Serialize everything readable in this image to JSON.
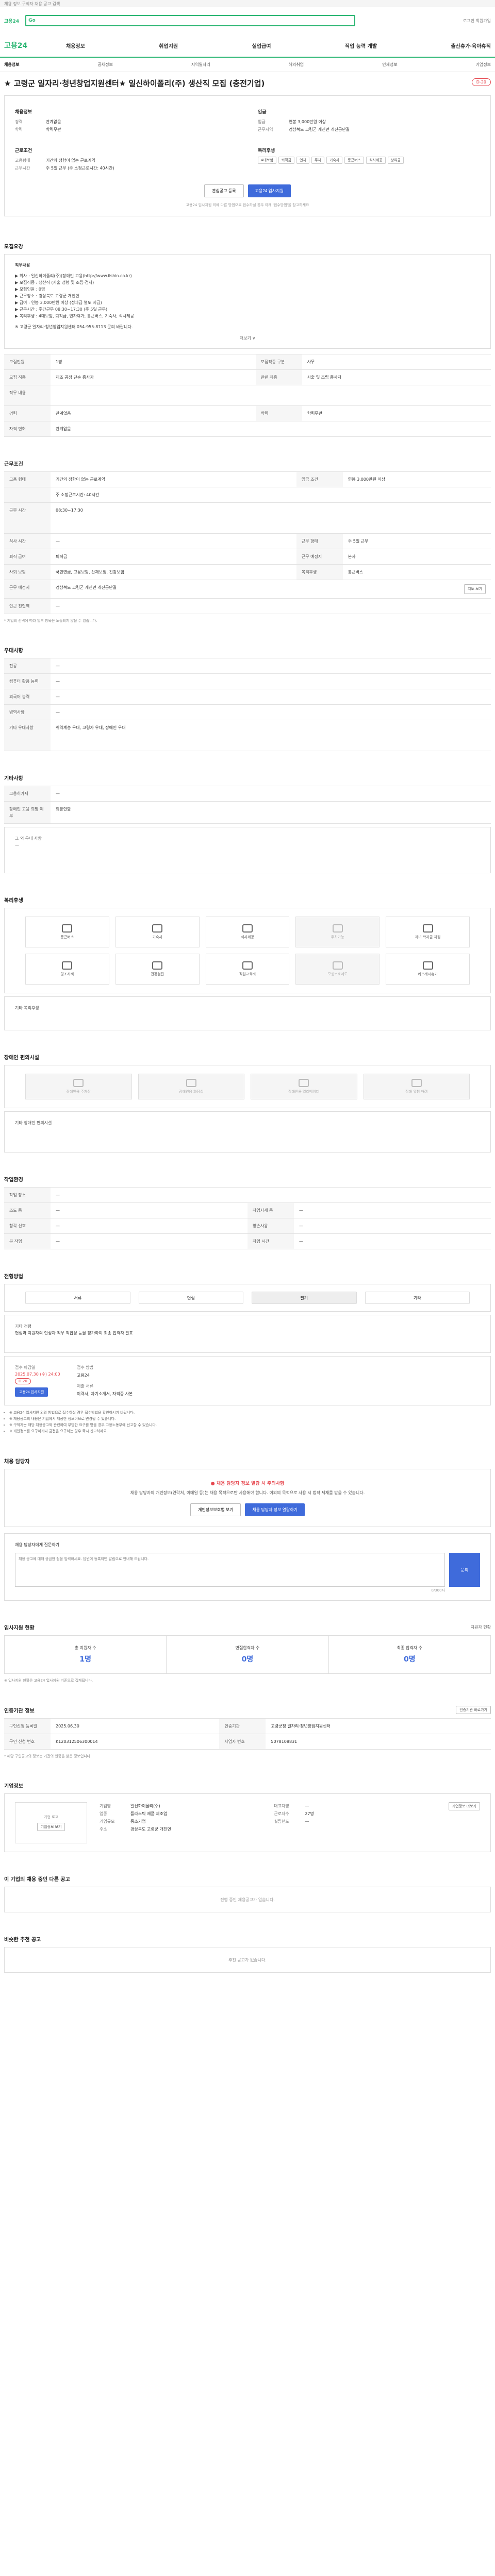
{
  "topstrip": {
    "text": "채용 정보 구직자 채용 공고 검색"
  },
  "search": {
    "logo": "고용24",
    "go": "Go",
    "placeholder": "",
    "util": "로그인 회원가입"
  },
  "gnb": {
    "brand": "고용24",
    "menu": [
      "채용정보",
      "취업지원",
      "실업급여",
      "직업 능력 개발",
      "출산휴가·육아휴직"
    ]
  },
  "subnav": {
    "items": [
      "채용정보",
      "공채정보",
      "지역일자리",
      "해외취업",
      "인재정보",
      "기업정보"
    ]
  },
  "title": {
    "text": "★ 고령군 일자리·청년창업지원센터★ 일신하이폴리(주) 생산직 모집 (충전기업)",
    "dday": "D-20"
  },
  "summary": {
    "left_head": "채용정보",
    "left": [
      {
        "k": "경력",
        "v": "관계없음"
      },
      {
        "k": "학력",
        "v": "학력무관"
      }
    ],
    "left2_head": "근로조건",
    "left2": [
      {
        "k": "고용형태",
        "v": "기간의 정함이 없는 근로계약"
      },
      {
        "k": "근무시간",
        "v": "주 5일 근무 (주 소정근로시간: 40시간)"
      }
    ],
    "right_head": "임금",
    "right": [
      {
        "k": "임금",
        "v": "연봉 3,000만원 이상"
      },
      {
        "k": "근무지역",
        "v": "경상북도 고령군 개진면 개진공단길"
      }
    ],
    "right2_head": "복리후생",
    "tags": [
      "4대보험",
      "퇴직금",
      "연차",
      "주차",
      "기숙사",
      "통근버스",
      "식사제공",
      "상여금"
    ],
    "btn_like": "관심공고 등록",
    "btn_apply": "고용24 입사지원",
    "note": "고용24 입사지원 외에 다른 방법으로 접수하실 경우 아래 '접수방법'을 참고하세요"
  },
  "recruit": {
    "head": "모집요강",
    "lines": [
      "직무내용",
      "▶ 회사 : 일신하이폴리(주)(장애인 고용(http://www.ilshin.co.kr)",
      "▶ 모집직종 : 생산직 (사출 성형 및 조립·검사)",
      "▶ 모집인원 : 0명",
      "▶ 근무장소 : 경상북도 고령군 개진면",
      "▶ 급여 : 연봉 3,000만원 이상 (성과급 별도 지급)",
      "▶ 근무시간 : 주간근무 08:30~17:30 (주 5일 근무)",
      "▶ 복리후생 : 4대보험, 퇴직금, 연차휴가, 통근버스, 기숙사, 식사제공",
      "※ 고령군 일자리·청년창업지원센터 054-955-8113 문의 바랍니다."
    ],
    "more": "더보기 ∨"
  },
  "jobinfo": [
    {
      "k1": "모집인원",
      "v1": "1명",
      "k2": "모집직종 구분",
      "v2": "사무"
    },
    {
      "k1": "모집 직종",
      "v1": "제조 공정 단순 종사자",
      "k2": "관련 직종",
      "v2": "사출 및 조립 종사자"
    },
    {
      "k1": "직무 내용",
      "v1": "",
      "k2": "",
      "v2": ""
    },
    {
      "k1": "경력",
      "v1": "관계없음",
      "k2": "학력",
      "v2": "학력무관"
    },
    {
      "k1": "자격 면허",
      "v1": "관계없음",
      "k2": "",
      "v2": ""
    }
  ],
  "work": {
    "head": "근무조건",
    "rows": [
      {
        "k1": "고용 형태",
        "v1": "기간의 정함이 없는 근로계약",
        "k2": "임금 조건",
        "v2": "연봉 3,000만원 이상"
      },
      {
        "k1": "",
        "v1": "주 소정근로시간: 40시간",
        "k2": "",
        "v2": ""
      },
      {
        "k1": "근무 시간",
        "v1": "08:30~17:30",
        "k2": "",
        "v2": ""
      },
      {
        "k1": "식사 시간",
        "v1": "—",
        "k2": "근무 형태",
        "v2": "주 5일 근무"
      },
      {
        "k1": "퇴직 급여",
        "v1": "퇴직금",
        "k2": "근무 예정지",
        "v2": "본사"
      },
      {
        "k1": "사회 보험",
        "v1": "국민연금, 고용보험, 산재보험, 건강보험",
        "k2": "복리후생",
        "v2": "통근버스"
      },
      {
        "k1": "근무 예정지",
        "v1": "경상북도 고령군 개진면 개진공단길",
        "k2": "",
        "v2": ""
      },
      {
        "k1": "인근 전철역",
        "v1": "—",
        "k2": "",
        "v2": ""
      }
    ],
    "map_btn": "지도 보기",
    "footnote": "* 기업의 선택에 따라 일부 항목은 노출되지 않을 수 있습니다."
  },
  "preference": {
    "head": "우대사항",
    "rows": [
      {
        "k": "전공",
        "v": "—"
      },
      {
        "k": "컴퓨터 활용 능력",
        "v": "—"
      },
      {
        "k": "외국어 능력",
        "v": "—"
      },
      {
        "k": "병역사항",
        "v": "—"
      },
      {
        "k": "기타 우대사항",
        "v": "취약계층 우대, 고령자 우대, 장애인 우대"
      }
    ]
  },
  "etc": {
    "head": "기타사항",
    "rows": [
      {
        "k": "고용허가제",
        "v": "—"
      },
      {
        "k": "장애인 고용 희망 여부",
        "v": "희망안함"
      },
      {
        "k": "그 외 우대 사항",
        "v": "—"
      }
    ]
  },
  "welfare": {
    "head": "복리후생",
    "items": [
      {
        "l": "통근버스",
        "on": true
      },
      {
        "l": "기숙사",
        "on": true
      },
      {
        "l": "식사제공",
        "on": true
      },
      {
        "l": "주차가능",
        "on": false
      },
      {
        "l": "자녀 학자금 지원",
        "on": true
      },
      {
        "l": "경조사비",
        "on": true
      },
      {
        "l": "건강검진",
        "on": true
      },
      {
        "l": "직원교육비",
        "on": true
      },
      {
        "l": "모성보호제도",
        "on": false
      },
      {
        "l": "리프레시휴가",
        "on": true
      }
    ],
    "other_label": "기타 복리후생"
  },
  "disability": {
    "head": "장애인 편의시설",
    "items": [
      "장애인용 주차장",
      "장애인용 화장실",
      "장애인용 엘리베이터",
      "장애 유형 배려"
    ],
    "other_label": "기타 장애인 편의시설"
  },
  "company_env": {
    "head": "작업환경",
    "rows": [
      {
        "k1": "작업 장소",
        "v1": "—",
        "k2": "",
        "v2": ""
      },
      {
        "k1": "조도 등",
        "v1": "—",
        "k2": "작업자세 등",
        "v2": "—"
      },
      {
        "k1": "청각 신호",
        "v1": "—",
        "k2": "양손사용",
        "v2": "—"
      },
      {
        "k1": "분 작업",
        "v1": "—",
        "k2": "작업 시간",
        "v2": "—"
      }
    ]
  },
  "selection": {
    "head": "전형방법",
    "steps": [
      "서류",
      "면접",
      "필기",
      "기타"
    ],
    "other_label": "기타 전형",
    "other_v": "면접과 지원자의 인성과 직무 적합성 등을 평가하여 최종 합격자 발표"
  },
  "apply": {
    "k1": "접수 마감일",
    "v1": "2025.07.30 (수) 24:00",
    "dday": "D-20",
    "btn": "고용24 입사지원",
    "k2": "접수 방법",
    "v2": "고용24",
    "k3": "제출 서류",
    "v3": "이력서, 자기소개서, 자격증 사본"
  },
  "apply_notes": [
    "※ 고용24 입사지원 외의 방법으로 접수하실 경우 접수방법을 확인하시기 바랍니다.",
    "※ 채용공고의 내용은 기업에서 제공한 정보이므로 변경될 수 있습니다.",
    "※ 구직자는 해당 채용공고와 관련하여 부당한 요구를 받을 경우 고용노동부에 신고할 수 있습니다.",
    "※ 개인정보를 요구하거나 금전을 요구하는 경우 즉시 신고하세요."
  ],
  "recruiter": {
    "head": "채용 담당자",
    "warn_title": "채용 담당자 정보 열람 시 주의사항",
    "warn_text": "채용 담당자의 개인정보(연락처, 이메일 등)는 채용 목적으로만 사용해야 합니다. 이외의 목적으로 사용 시 법적 제재를 받을 수 있습니다.",
    "btn_view": "개인정보보호법 보기",
    "btn_contact": "채용 담당자 정보 열람하기"
  },
  "inquiry": {
    "head": "채용 담당자에게 질문하기",
    "placeholder": "채용 공고에 대해 궁금한 점을 입력하세요. 답변이 등록되면 알림으로 안내해 드립니다.",
    "btn": "문의",
    "counter": "0/300자"
  },
  "status": {
    "head": "입사지원 현황",
    "right": "지원자 현황",
    "items": [
      {
        "t": "총 지원자 수",
        "n": "1명"
      },
      {
        "t": "면접합격자 수",
        "n": "0명"
      },
      {
        "t": "최종 합격자 수",
        "n": "0명"
      }
    ],
    "note": "※ 입사지원 현황은 고용24 입사지원 기준으로 집계됩니다."
  },
  "meta": {
    "head": "인증기관 정보",
    "right": "인증기관 바로가기",
    "rows": [
      {
        "k1": "구인신청 등록일",
        "v1": "2025.06.30",
        "k2": "인증기관",
        "v2": "고령군청 일자리·청년창업지원센터"
      },
      {
        "k1": "구인 신청 번호",
        "v1": "K120312506300014",
        "k2": "사업자 번호",
        "v2": "5078108831"
      }
    ],
    "note": "* 해당 구인공고의 정보는 기관의 인증을 받은 정보입니다."
  },
  "company": {
    "head": "기업정보",
    "logo_alt": "기업 로고",
    "logo_btn": "기업정보 보기",
    "rows": [
      {
        "k": "기업명",
        "v": "일신하이폴리(주)"
      },
      {
        "k": "업종",
        "v": "플라스틱 제품 제조업"
      },
      {
        "k": "기업규모",
        "v": "중소기업"
      },
      {
        "k": "주소",
        "v": "경상북도 고령군 개진면"
      }
    ],
    "rows2": [
      {
        "k": "대표자명",
        "v": "—"
      },
      {
        "k": "근로자수",
        "v": "27명"
      },
      {
        "k": "설립년도",
        "v": "—"
      }
    ],
    "btn": "기업정보 더보기"
  },
  "other_jobs": {
    "head": "이 기업의 채용 중인 다른 공고",
    "empty": "진행 중인 채용공고가 없습니다."
  },
  "recommend": {
    "head": "비슷한 추천 공고",
    "empty": "추천 공고가 없습니다."
  }
}
